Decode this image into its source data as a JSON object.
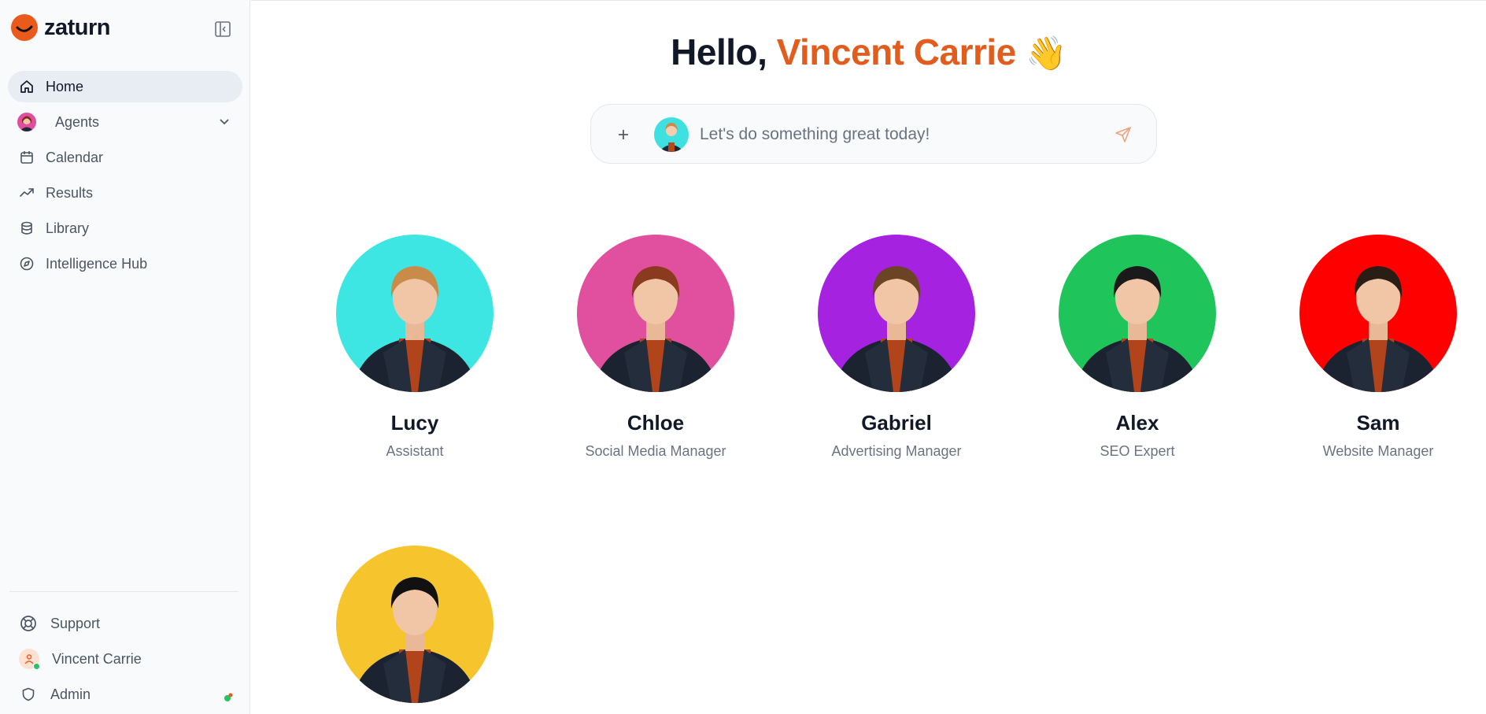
{
  "app": {
    "brand": "zaturn"
  },
  "sidebar": {
    "items": [
      {
        "label": "Home",
        "icon": "home-icon"
      },
      {
        "label": "Agents",
        "icon": "agent-avatar"
      },
      {
        "label": "Calendar",
        "icon": "calendar-icon"
      },
      {
        "label": "Results",
        "icon": "trending-up-icon"
      },
      {
        "label": "Library",
        "icon": "database-icon"
      },
      {
        "label": "Intelligence Hub",
        "icon": "compass-icon"
      }
    ],
    "bottom": [
      {
        "label": "Support",
        "icon": "lifebuoy-icon"
      },
      {
        "label": "Vincent Carrie",
        "icon": "user-avatar"
      },
      {
        "label": "Admin",
        "icon": "shield-icon"
      }
    ]
  },
  "main": {
    "greeting_prefix": "Hello, ",
    "greeting_name": "Vincent Carrie",
    "greeting_emoji": "👋",
    "prompt_placeholder": "Let's do something great today!"
  },
  "agents": [
    {
      "name": "Lucy",
      "role": "Assistant",
      "color": "#3ee6e3",
      "hair": "#c98b4a"
    },
    {
      "name": "Chloe",
      "role": "Social Media Manager",
      "color": "#e0509f",
      "hair": "#8a3a1f"
    },
    {
      "name": "Gabriel",
      "role": "Advertising Manager",
      "color": "#a522e0",
      "hair": "#6b4426"
    },
    {
      "name": "Alex",
      "role": "SEO Expert",
      "color": "#1fc45b",
      "hair": "#1a1a1a"
    },
    {
      "name": "Sam",
      "role": "Website Manager",
      "color": "#ff0000",
      "hair": "#2a1d15"
    },
    {
      "name": "",
      "role": "",
      "color": "#f6c52e",
      "hair": "#111111"
    }
  ],
  "colors": {
    "accent": "#e25c1d",
    "active_nav_bg": "#e8edf4"
  }
}
